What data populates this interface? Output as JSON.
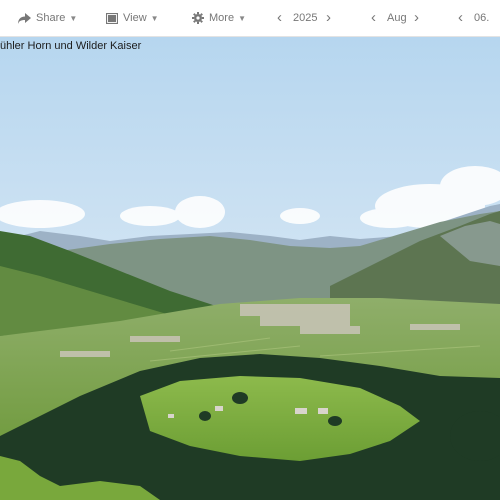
{
  "toolbar": {
    "share_label": "Share",
    "view_label": "View",
    "more_label": "More",
    "year_value": "2025",
    "month_value": "Aug",
    "day_value": "06."
  },
  "photo": {
    "caption": "ühler Horn und Wilder Kaiser"
  },
  "colors": {
    "toolbar_text": "#777777",
    "sky_top": "#b6d6ef",
    "sky_bottom": "#e8f1f8",
    "meadow": "#7fae3e",
    "forest": "#1f3b25"
  },
  "icons": [
    "share-icon",
    "view-icon",
    "gear-icon",
    "chevron-left-icon",
    "chevron-right-icon",
    "caret-down-icon"
  ]
}
